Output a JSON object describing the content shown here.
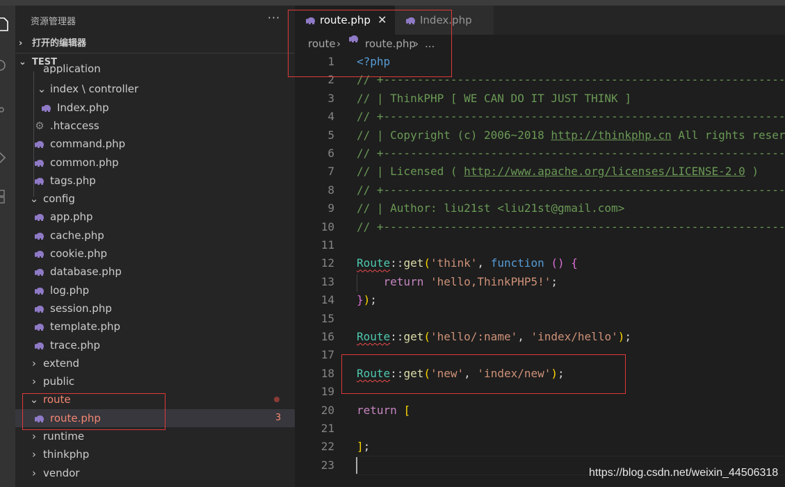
{
  "sidebar": {
    "title": "资源管理器",
    "more": "···",
    "open_editors": "打开的编辑器",
    "workspace": "TEST",
    "items": [
      {
        "label": "application",
        "depth": 1,
        "arrow": "",
        "icon": ""
      },
      {
        "label": "index \\ controller",
        "depth": 2,
        "arrow": "⌄",
        "icon": ""
      },
      {
        "label": "Index.php",
        "depth": 3,
        "arrow": "",
        "icon": "php"
      },
      {
        "label": ".htaccess",
        "depth": 2,
        "arrow": "",
        "icon": "gear"
      },
      {
        "label": "command.php",
        "depth": 2,
        "arrow": "",
        "icon": "php"
      },
      {
        "label": "common.php",
        "depth": 2,
        "arrow": "",
        "icon": "php"
      },
      {
        "label": "tags.php",
        "depth": 2,
        "arrow": "",
        "icon": "php"
      },
      {
        "label": "config",
        "depth": 1,
        "arrow": "⌄",
        "icon": ""
      },
      {
        "label": "app.php",
        "depth": 2,
        "arrow": "",
        "icon": "php"
      },
      {
        "label": "cache.php",
        "depth": 2,
        "arrow": "",
        "icon": "php"
      },
      {
        "label": "cookie.php",
        "depth": 2,
        "arrow": "",
        "icon": "php"
      },
      {
        "label": "database.php",
        "depth": 2,
        "arrow": "",
        "icon": "php"
      },
      {
        "label": "log.php",
        "depth": 2,
        "arrow": "",
        "icon": "php"
      },
      {
        "label": "session.php",
        "depth": 2,
        "arrow": "",
        "icon": "php"
      },
      {
        "label": "template.php",
        "depth": 2,
        "arrow": "",
        "icon": "php"
      },
      {
        "label": "trace.php",
        "depth": 2,
        "arrow": "",
        "icon": "php"
      },
      {
        "label": "extend",
        "depth": 1,
        "arrow": "›",
        "icon": ""
      },
      {
        "label": "public",
        "depth": 1,
        "arrow": "›",
        "icon": ""
      },
      {
        "label": "route",
        "depth": 1,
        "arrow": "⌄",
        "icon": ""
      },
      {
        "label": "route.php",
        "depth": 2,
        "arrow": "",
        "icon": "php"
      },
      {
        "label": "runtime",
        "depth": 1,
        "arrow": "›",
        "icon": ""
      },
      {
        "label": "thinkphp",
        "depth": 1,
        "arrow": "›",
        "icon": ""
      },
      {
        "label": "vendor",
        "depth": 1,
        "arrow": "›",
        "icon": ""
      }
    ],
    "route_problem_count": "3"
  },
  "tabs": [
    {
      "label": "route.php",
      "active": true,
      "close": "✕"
    },
    {
      "label": "Index.php",
      "active": false
    }
  ],
  "breadcrumb": {
    "folder": "route",
    "file": "route.php",
    "more": "..."
  },
  "editor": {
    "line_numbers": [
      "1",
      "2",
      "3",
      "4",
      "5",
      "6",
      "7",
      "8",
      "9",
      "10",
      "11",
      "12",
      "13",
      "14",
      "15",
      "16",
      "17",
      "18",
      "19",
      "20",
      "21",
      "22",
      "23"
    ],
    "comment_rule": "// +----------------------------------------------------------------------",
    "comment_line3": "// | ThinkPHP [ WE CAN DO IT JUST THINK ]",
    "comment_line5_pre": "// | Copyright (c) 2006~2018 ",
    "comment_line5_link": "http://thinkphp.cn",
    "comment_line5_post": " All rights reserved.",
    "comment_line7_pre": "// | Licensed ( ",
    "comment_line7_link": "http://www.apache.org/licenses/LICENSE-2.0",
    "comment_line7_post": " )",
    "comment_line9": "// | Author: liu21st <liu21st@gmail.com>",
    "php_open": "<?php",
    "route_class": "Route",
    "sep": "::",
    "get_fn": "get",
    "open_paren": "(",
    "close_paren": ")",
    "comma": ", ",
    "semicolon": ";",
    "str_think": "'think'",
    "kw_function": "function",
    "empty_params": "()",
    "open_brace": "{",
    "return_kw": "return",
    "str_hello_tp5": "'hello,ThinkPHP5!'",
    "close_brace": "}",
    "str_hello_name": "'hello/:name'",
    "str_index_hello": "'index/hello'",
    "str_new": "'new'",
    "str_index_new": "'index/new'",
    "open_bracket": "[",
    "close_bracket": "]"
  },
  "watermark": "https://blog.csdn.net/weixin_44506318",
  "colors": {
    "highlight_box": "#e03a3a",
    "php_icon": "#8f7ac6",
    "problem_text": "#f48771"
  }
}
